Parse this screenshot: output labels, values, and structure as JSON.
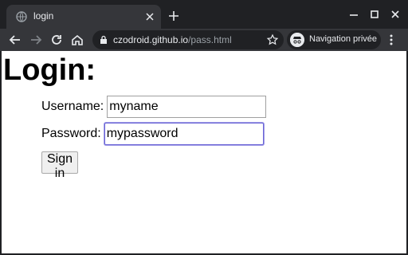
{
  "browser": {
    "tab": {
      "title": "login"
    },
    "address": {
      "host": "czodroid.github.io",
      "path": "/pass.html"
    },
    "profile": {
      "label": "Navigation privée"
    }
  },
  "page": {
    "title": "Login:",
    "username": {
      "label": "Username:",
      "value": "myname"
    },
    "password": {
      "label": "Password:",
      "value": "mypassword"
    },
    "submit_label": "Sign in"
  },
  "colors": {
    "chrome_dark": "#202124",
    "toolbar": "#35363a",
    "focus_ring": "#6b65d6"
  }
}
